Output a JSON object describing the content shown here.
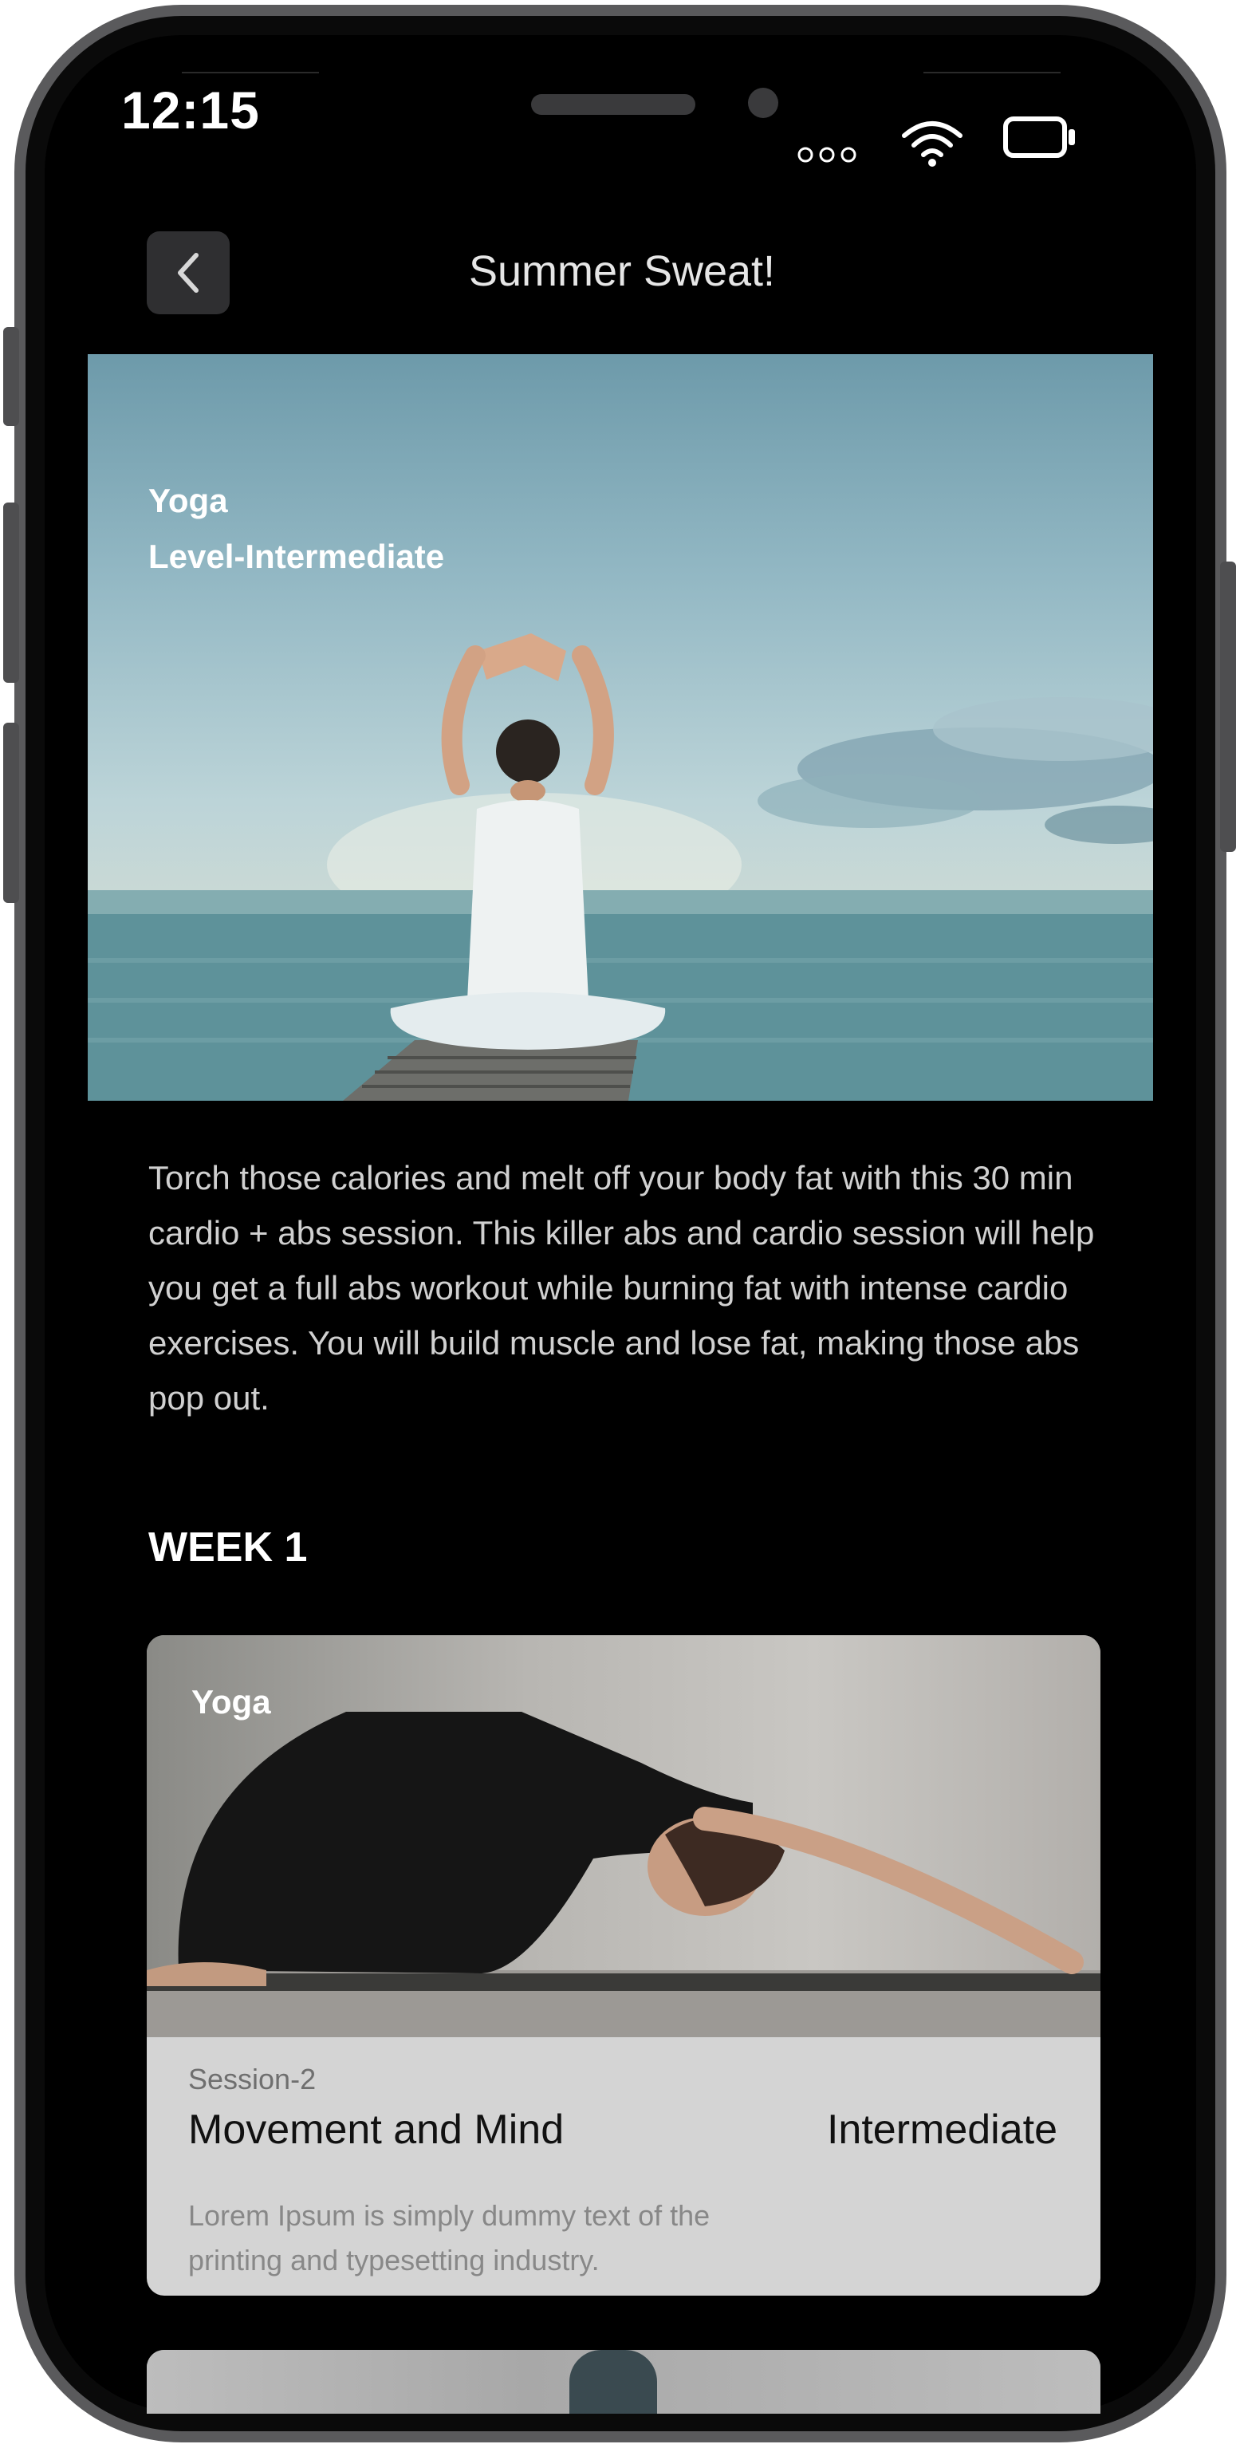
{
  "status_bar": {
    "time": "12:15"
  },
  "nav": {
    "title": "Summer Sweat!"
  },
  "hero": {
    "category": "Yoga",
    "level": "Level-Intermediate"
  },
  "description": "Torch those calories and melt off your body fat with this 30 min cardio + abs session. This killer abs and cardio session will help you get a full abs workout while burning fat with intense cardio exercises. You will build muscle and lose fat, making those abs pop out.",
  "week": {
    "heading": "WEEK 1"
  },
  "sessions": [
    {
      "tag": "Yoga",
      "session": "Session-2",
      "title": "Movement and Mind",
      "level": "Intermediate",
      "description": "Lorem Ipsum is simply dummy text of the printing and typesetting industry."
    }
  ],
  "colors": {
    "background": "#000000",
    "card": "#d4d4d4",
    "text_primary": "#ffffff"
  }
}
